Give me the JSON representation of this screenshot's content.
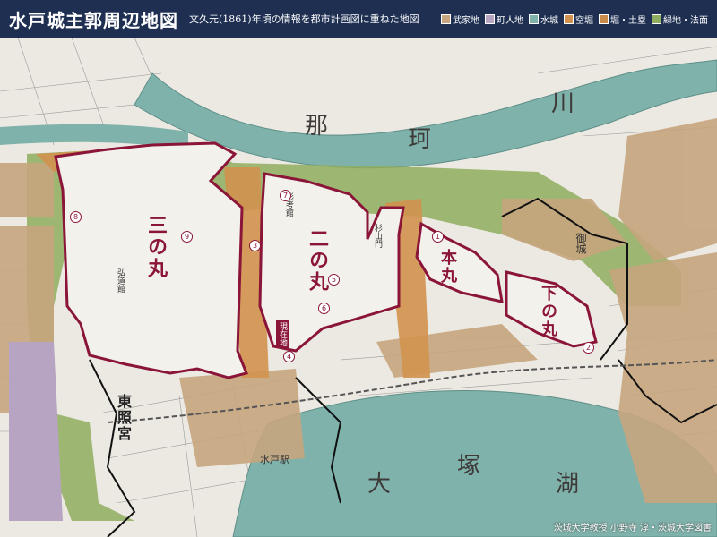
{
  "header": {
    "title": "水戸城主郭周辺地図",
    "subtitle": "文久元(1861)年頃の情報を都市計画図に重ねた地図"
  },
  "legend": [
    {
      "label": "武家地",
      "color": "#c7a57e"
    },
    {
      "label": "町人地",
      "color": "#b7a3c2"
    },
    {
      "label": "水城",
      "color": "#7fb2ab"
    },
    {
      "label": "空堀",
      "color": "#d2924f"
    },
    {
      "label": "堀・土塁",
      "color": "#c98b4a"
    },
    {
      "label": "緑地・法面",
      "color": "#8fad5e"
    }
  ],
  "map": {
    "enclosures": [
      "三の丸",
      "二の丸",
      "本丸",
      "下の丸"
    ],
    "river_chars": [
      "那",
      "珂",
      "川"
    ],
    "lake_chars": [
      "大",
      "塚",
      "湖"
    ],
    "landmarks": [
      "東照宮",
      "水戸駅",
      "弘道館",
      "御城",
      "彰考館",
      "杉山門"
    ],
    "current_location": "現在地",
    "markers": [
      "1",
      "2",
      "3",
      "4",
      "5",
      "6",
      "7",
      "8",
      "9"
    ]
  },
  "credit": "茨城大学教授 小野寺 淳・茨城大学図書"
}
